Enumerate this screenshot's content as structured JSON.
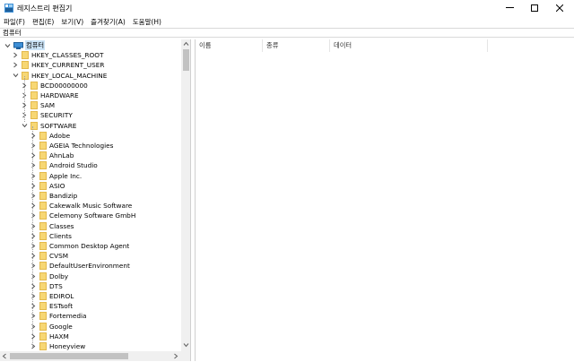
{
  "window": {
    "title": "레지스트리 편집기",
    "icon": "regedit-icon",
    "minimize_icon": "minimize-icon",
    "maximize_icon": "maximize-icon",
    "close_icon": "close-icon"
  },
  "menu": [
    "파일(F)",
    "편집(E)",
    "보기(V)",
    "즐겨찾기(A)",
    "도움말(H)"
  ],
  "address": "컴퓨터",
  "tree": {
    "root": "컴퓨터",
    "hives": [
      "HKEY_CLASSES_ROOT",
      "HKEY_CURRENT_USER",
      "HKEY_LOCAL_MACHINE"
    ],
    "hklm_children": [
      "BCD00000000",
      "HARDWARE",
      "SAM",
      "SECURITY",
      "SOFTWARE"
    ],
    "software_children": [
      "Adobe",
      "AGEIA Technologies",
      "AhnLab",
      "Android Studio",
      "Apple Inc.",
      "ASIO",
      "Bandizip",
      "Cakewalk Music Software",
      "Celemony Software GmbH",
      "Classes",
      "Clients",
      "Common Desktop Agent",
      "CVSM",
      "DefaultUserEnvironment",
      "Dolby",
      "DTS",
      "EDIROL",
      "ESTsoft",
      "Fortemedia",
      "Google",
      "HAXM",
      "Honeyview"
    ]
  },
  "list": {
    "columns": [
      "이름",
      "종류",
      "데이터"
    ]
  },
  "colors": {
    "selection": "#cce4f7",
    "folder": "#f7d774",
    "computer_icon": "#3d8fd6"
  }
}
